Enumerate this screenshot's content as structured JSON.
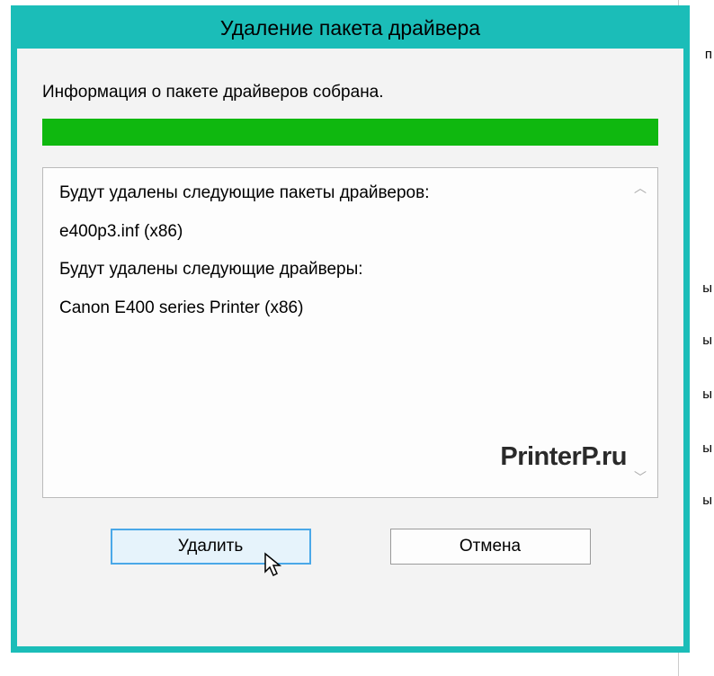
{
  "dialog": {
    "title": "Удаление пакета драйвера",
    "status": "Информация о пакете драйверов собрана.",
    "details": {
      "packages_header": "Будут удалены следующие пакеты драйверов:",
      "package_item": "e400p3.inf (x86)",
      "drivers_header": "Будут удалены следующие драйверы:",
      "driver_item": "Canon E400 series Printer (x86)"
    },
    "watermark": "PrinterP.ru",
    "buttons": {
      "delete": "Удалить",
      "cancel": "Отмена"
    }
  },
  "background": {
    "frag1": "п",
    "frag2": "ы",
    "frag3": "ы",
    "frag4": "ы",
    "frag5": "ы",
    "frag6": "ы"
  }
}
